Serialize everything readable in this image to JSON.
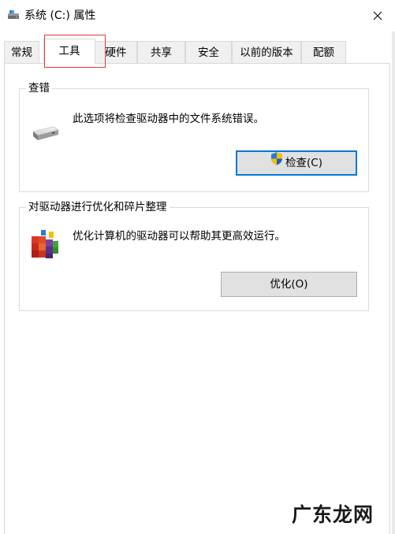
{
  "window": {
    "title": "系统 (C:) 属性",
    "close_label": "✕"
  },
  "tabs": [
    {
      "label": "常规",
      "active": false
    },
    {
      "label": "工具",
      "active": true
    },
    {
      "label": "硬件",
      "active": false
    },
    {
      "label": "共享",
      "active": false
    },
    {
      "label": "安全",
      "active": false
    },
    {
      "label": "以前的版本",
      "active": false
    },
    {
      "label": "配额",
      "active": false
    }
  ],
  "error_check": {
    "legend": "查错",
    "description": "此选项将检查驱动器中的文件系统错误。",
    "button_label": "检查(C)",
    "icon": "drive-icon"
  },
  "optimize": {
    "legend": "对驱动器进行优化和碎片整理",
    "description": "优化计算机的驱动器可以帮助其更高效运行。",
    "button_label": "优化(O)",
    "icon": "defrag-icon"
  },
  "watermark": "广东龙网",
  "colors": {
    "highlight": "#e23a3a",
    "default_button_border": "#0078d7",
    "button_bg": "#e1e1e1"
  }
}
